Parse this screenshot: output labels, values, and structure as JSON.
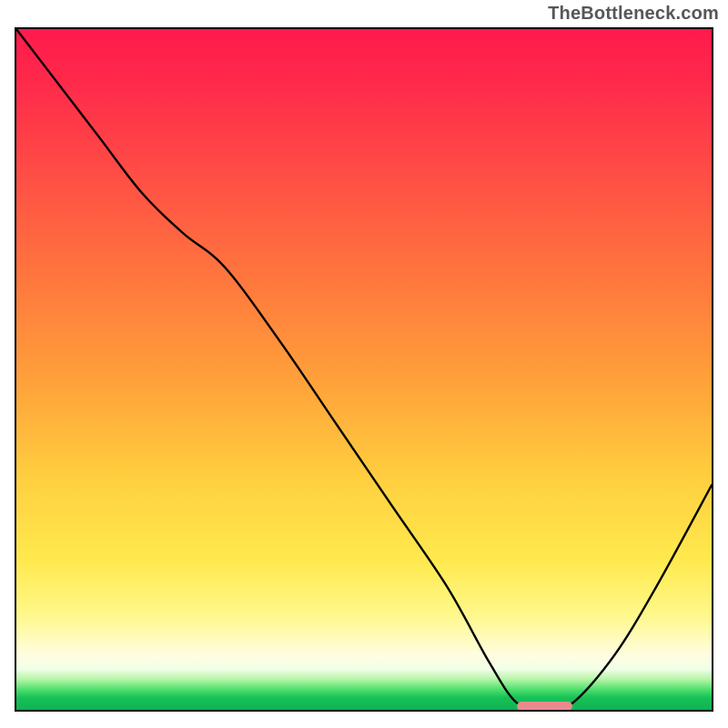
{
  "watermark": "TheBottleneck.com",
  "chart_data": {
    "type": "line",
    "title": "",
    "xlabel": "",
    "ylabel": "",
    "xlim": [
      0,
      100
    ],
    "ylim": [
      0,
      100
    ],
    "grid": false,
    "legend": false,
    "series": [
      {
        "name": "bottleneck-curve",
        "x": [
          0,
          6,
          12,
          18,
          24,
          30,
          38,
          46,
          54,
          62,
          68,
          72,
          76,
          80,
          86,
          92,
          100
        ],
        "y": [
          100,
          92,
          84,
          76,
          70,
          65,
          54,
          42,
          30,
          18,
          7,
          1,
          0,
          1,
          8,
          18,
          33
        ]
      }
    ],
    "annotations": [
      {
        "name": "optimal-marker",
        "x_start": 72,
        "x_end": 80,
        "y": 0.5,
        "color": "#e98a8f"
      }
    ],
    "background_gradient": {
      "stops": [
        {
          "pos": 0.0,
          "color": "#ff1a4d"
        },
        {
          "pos": 0.38,
          "color": "#ff7a3d"
        },
        {
          "pos": 0.66,
          "color": "#ffcf3f"
        },
        {
          "pos": 0.86,
          "color": "#fff88a"
        },
        {
          "pos": 0.94,
          "color": "#f2ffe8"
        },
        {
          "pos": 0.97,
          "color": "#4fe06e"
        },
        {
          "pos": 1.0,
          "color": "#0fb351"
        }
      ]
    }
  }
}
